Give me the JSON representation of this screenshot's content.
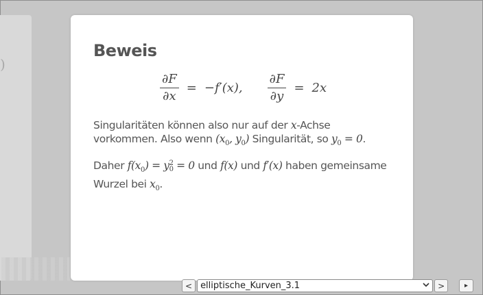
{
  "slide": {
    "title": "Beweis",
    "equation": {
      "f1_num": "∂F",
      "f1_den": "∂x",
      "eq_sign": "=",
      "rhs1": "−f′(x),",
      "f2_num": "∂F",
      "f2_den": "∂y",
      "rhs2": "2x"
    },
    "p1": {
      "t1": "Singularitäten können also nur auf der ",
      "m1": "x",
      "t2": "-Achse vorkommen. Also wenn ",
      "m2": "(x",
      "m2_sub1": "0",
      "m2_mid": ", y",
      "m2_sub2": "0",
      "m2_end": ")",
      "t3": " Singularität, so ",
      "m3": "y",
      "m3_sub": "0",
      "m3_end": " = 0",
      "t4": "."
    },
    "p2": {
      "t1": "Daher ",
      "m1": "f(x",
      "m1_sub": "0",
      "m1_mid": ") = y",
      "m1_sup": "2",
      "m1_sub2": "0",
      "m1_end": " = 0",
      "t2": " und ",
      "m2": "f(x)",
      "t3": " und ",
      "m3": "f′(x)",
      "t4": " haben gemeinsame Wurzel bei ",
      "m4": "x",
      "m4_sub": "0",
      "t5": "."
    }
  },
  "prev_slide_glyph": ")",
  "nav": {
    "prev_label": "<",
    "next_label": ">",
    "selected": "elliptische_Kurven_3.1",
    "play_label": "▸"
  }
}
